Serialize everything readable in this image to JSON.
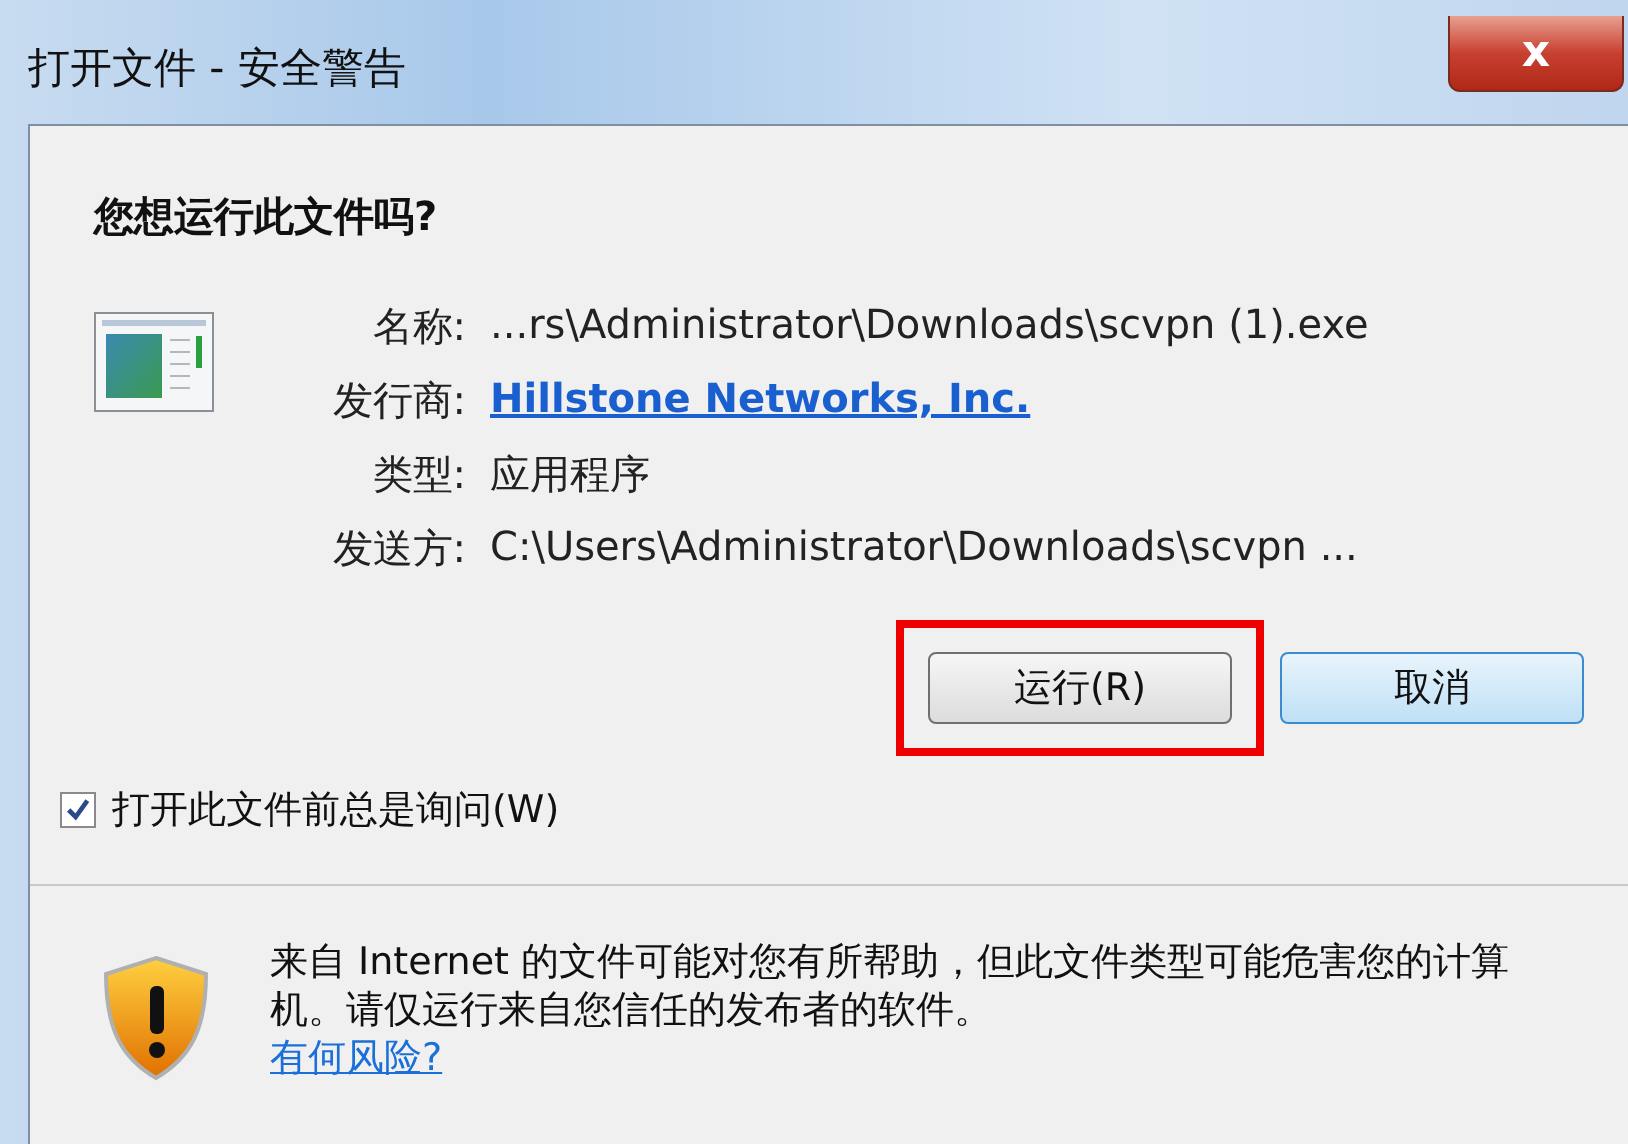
{
  "window": {
    "title": "打开文件 - 安全警告",
    "close": "x"
  },
  "heading": "您想运行此文件吗?",
  "fields": [
    {
      "label": "名称:",
      "value": "...rs\\Administrator\\Downloads\\scvpn (1).exe",
      "kind": "text"
    },
    {
      "label": "发行商:",
      "value": "Hillstone Networks, Inc.",
      "kind": "link"
    },
    {
      "label": "类型:",
      "value": "应用程序",
      "kind": "text"
    },
    {
      "label": "发送方:",
      "value": "C:\\Users\\Administrator\\Downloads\\scvpn ...",
      "kind": "text"
    }
  ],
  "buttons": [
    {
      "label": "运行(R)",
      "highlighted": true,
      "default": false
    },
    {
      "label": "取消",
      "highlighted": false,
      "default": true
    }
  ],
  "checkbox": {
    "label": "打开此文件前总是询问(W)",
    "checked": true
  },
  "warning": {
    "text": "来自 Internet 的文件可能对您有所帮助，但此文件类型可能危害您的计算机。请仅运行来自您信任的发布者的软件。",
    "link": "有何风险?"
  }
}
